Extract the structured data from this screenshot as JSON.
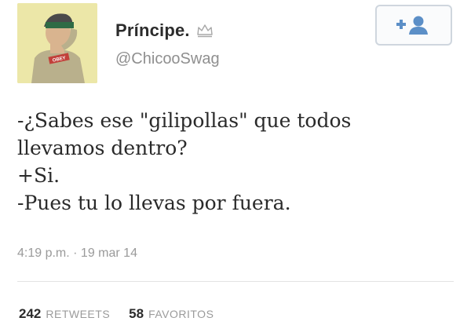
{
  "profile": {
    "display_name": "Príncipe.",
    "handle": "@ChicooSwag",
    "badge_icon": "crown-icon",
    "avatar_cap_text": "OBEY"
  },
  "follow_button": {
    "icon": "add-user-icon",
    "color": "#5c8fc7"
  },
  "tweet": {
    "lines": [
      "-¿Sabes ese \"gilipollas\" que todos",
      "llevamos dentro?",
      "+Si.",
      "-Pues tu lo llevas por fuera."
    ],
    "timestamp": "4:19 p.m. · 19 mar 14"
  },
  "stats": {
    "retweets_count": "242",
    "retweets_label": "RETWEETS",
    "favorites_count": "58",
    "favorites_label": "FAVORITOS"
  }
}
